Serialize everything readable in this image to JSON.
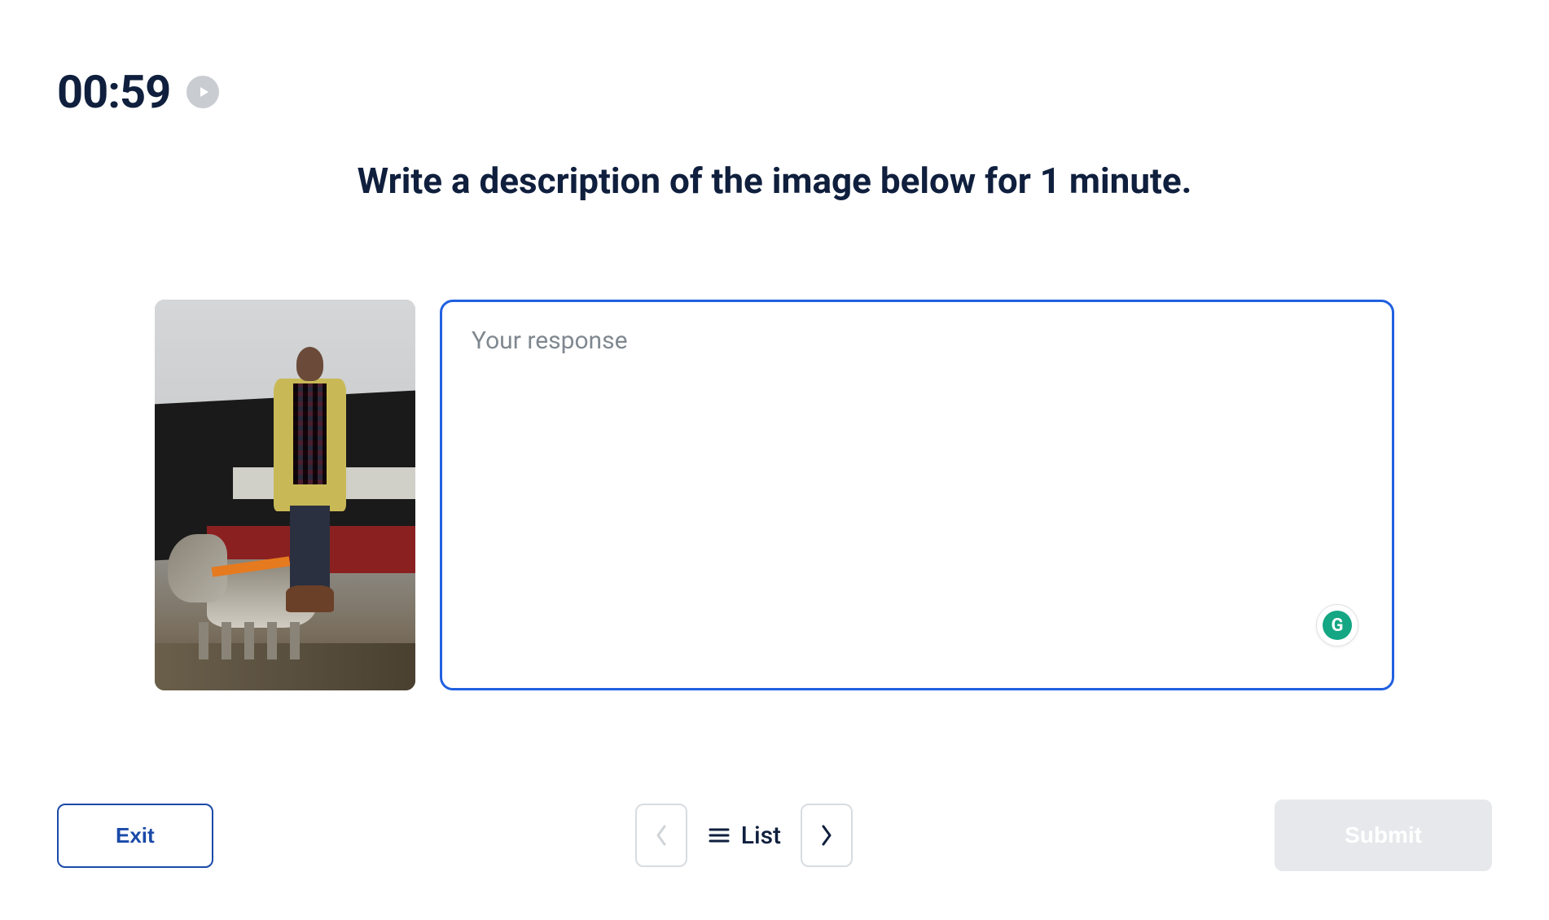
{
  "timer": {
    "value": "00:59"
  },
  "prompt": {
    "text": "Write a description of the image below for 1 minute."
  },
  "response": {
    "placeholder": "Your response",
    "value": ""
  },
  "grammarly": {
    "letter": "G"
  },
  "footer": {
    "exit_label": "Exit",
    "list_label": "List",
    "submit_label": "Submit"
  },
  "image": {
    "alt": "Person in yellow jacket standing with a dog near a ship at a dock"
  }
}
